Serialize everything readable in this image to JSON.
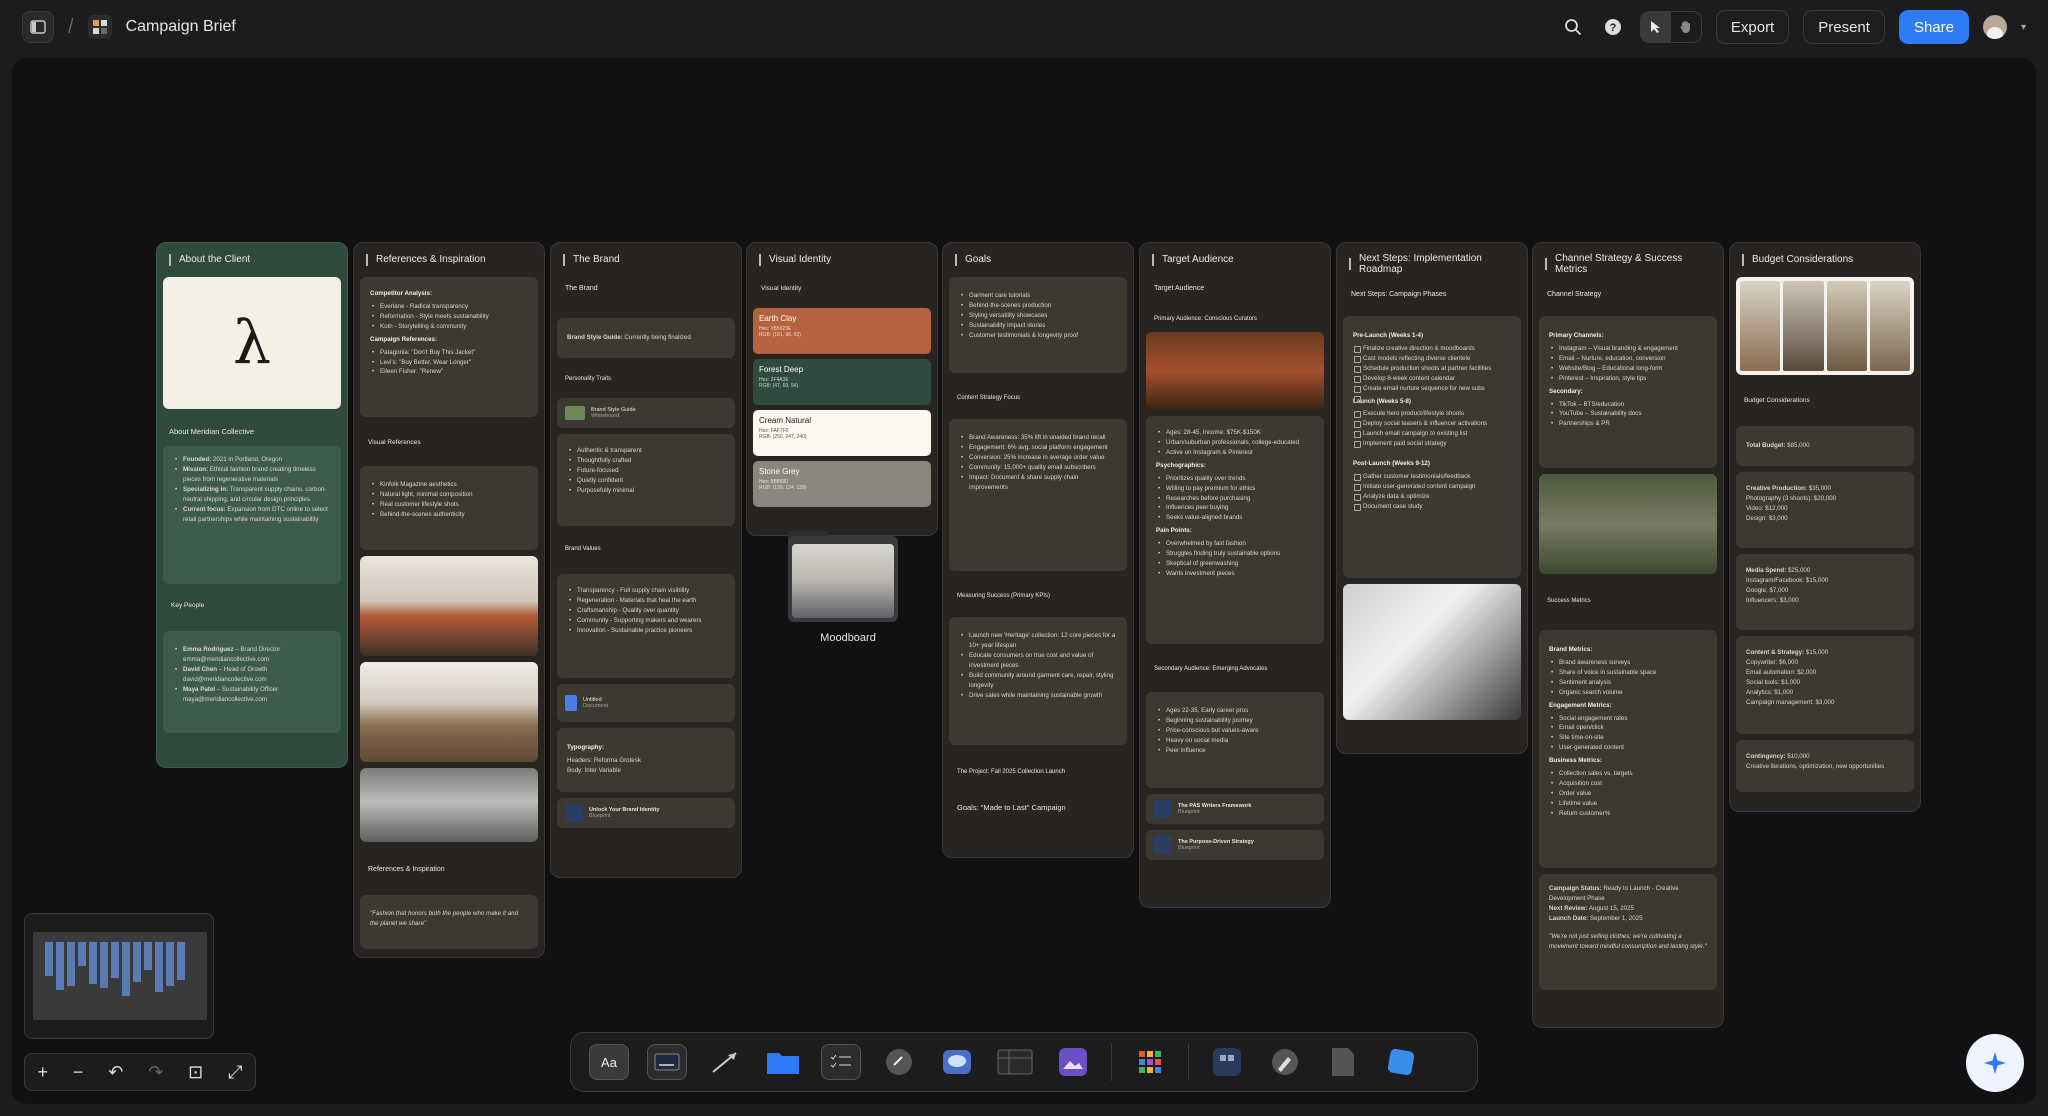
{
  "header": {
    "title": "Campaign Brief",
    "separator": "/",
    "export_label": "Export",
    "present_label": "Present",
    "share_label": "Share"
  },
  "columns": [
    {
      "title": "About the Client",
      "logo_letter": "λ",
      "org": "About Meridian Collective",
      "facts": [
        {
          "k": "Founded:",
          "v": "2021 in Portland, Oregon"
        },
        {
          "k": "Mission:",
          "v": "Ethical fashion brand creating timeless pieces from regenerative materials"
        },
        {
          "k": "Specializing in:",
          "v": "Transparent supply chains, carbon-neutral shipping, and circular design principles"
        },
        {
          "k": "Current focus:",
          "v": "Expansion from DTC online to select retail partnerships while maintaining sustainability"
        }
      ],
      "people_label": "Key People",
      "people": [
        {
          "name": "Emma Rodriguez",
          "role": " – Brand Director",
          "email": "emma@meridiancollective.com"
        },
        {
          "name": "David Chen",
          "role": " – Head of Growth",
          "email": "david@meridiancollective.com"
        },
        {
          "name": "Maya Patel",
          "role": " – Sustainability Officer",
          "email": "maya@meridiancollective.com"
        }
      ]
    },
    {
      "title": "References & Inspiration",
      "competitor_label": "Competitor Analysis:",
      "competitors": [
        "Everlane - Radical transparency",
        "Reformation - Style meets sustainability",
        "Kotn - Storytelling & community"
      ],
      "campaign_label": "Campaign References:",
      "campaigns": [
        "Patagonia: \"Don't Buy This Jacket\"",
        "Levi's: \"Buy Better, Wear Longer\"",
        "Eileen Fisher: \"Renew\""
      ],
      "visual_label": "Visual References",
      "visual": [
        "Kinfolk Magazine aesthetics",
        "Natural light, minimal composition",
        "Real customer lifestyle shots",
        "Behind-the-scenes authenticity"
      ],
      "footer_label": "References & Inspiration",
      "quote": "\"Fashion that honors both the people who make it and the planet we share\""
    },
    {
      "title": "The Brand",
      "sub_title": "The Brand",
      "style_guide_k": "Brand Style Guide:",
      "style_guide_v": " Currently being finalized",
      "traits_label": "Personality Traits",
      "file1_name": "Brand Style Guide",
      "file1_meta": "Whiteboard",
      "traits": [
        "Authentic & transparent",
        "Thoughtfully crafted",
        "Future-focused",
        "Quietly confident",
        "Purposefully minimal"
      ],
      "values_label": "Brand Values",
      "values": [
        "Transparency - Full supply chain visibility",
        "Regeneration - Materials that heal the earth",
        "Craftsmanship - Quality over quantity",
        "Community - Supporting makers and wearers",
        "Innovation - Sustainable practice pioneers"
      ],
      "file2_name": "Untitled",
      "file2_meta": "Document",
      "typo_label": "Typography:",
      "typo_head": "Headers: Reforma Grotesk",
      "typo_body": "Body: Inter Variable",
      "file3_name": "Unlock Your Brand Identity",
      "file3_meta": "Blueprint"
    },
    {
      "title": "Visual Identity",
      "sub_title": "Visual Identity",
      "swatches": [
        {
          "name": "Earth Clay",
          "hex": "Hex: #B5623E",
          "rgb": "RGB: (181, 98, 62)",
          "color": "#b5623e"
        },
        {
          "name": "Forest Deep",
          "hex": "Hex: 2F4A3E",
          "rgb": "RGB: (47, 69, 54)",
          "color": "#2f4a3e"
        },
        {
          "name": "Cream Natural",
          "hex": "Hex: FAF7F0",
          "rgb": "RGB: (250, 247, 240)",
          "color": "#faf7f0"
        },
        {
          "name": "Stone Grey",
          "hex": "Hex: 8B8680",
          "rgb": "RGB: (139, 134, 128)",
          "color": "#8b8680"
        }
      ],
      "folder_label": "Moodboard"
    },
    {
      "title": "Goals",
      "goals": [
        "Garment care tutorials",
        "Behind-the-scenes production",
        "Styling versatility showcases",
        "Sustainability impact stories",
        "Customer testimonials & longevity proof"
      ],
      "focus_label": "Content Strategy Focus",
      "focus": [
        "Brand Awareness: 35% lift in unaided brand recall",
        "Engagement: 6% avg. social platform engagement",
        "Conversion: 25% increase in average order value",
        "Community: 15,000+ quality email subscribers",
        "Impact: Document & share supply chain improvements"
      ],
      "kpi_label": "Measuring Success (Primary KPIs)",
      "kpis": [
        "Launch new 'Heritage' collection: 12 core pieces for a 10+ year lifespan",
        "Educate consumers on true cost and value of investment pieces",
        "Build community around garment care, repair, styling longevity",
        "Drive sales while maintaining sustainable growth"
      ],
      "project_label": "The Project: Fall 2025 Collection Launch",
      "goal_label": "Goals: \"Made to Last\" Campaign"
    },
    {
      "title": "Target Audience",
      "sub_title": "Target Audience",
      "primary_label": "Primary Audience: Conscious Curators",
      "primary": [
        "Ages: 28-45, Income: $75K-$150K",
        "Urban/suburban professionals, college-educated",
        "Active on Instagram & Pinterest"
      ],
      "psy_label": "Psychographics:",
      "psy": [
        "Prioritizes quality over trends",
        "Willing to pay premium for ethics",
        "Researches before purchasing",
        "Influences peer buying",
        "Seeks value-aligned brands"
      ],
      "pain_label": "Pain Points:",
      "pain": [
        "Overwhelmed by fast fashion",
        "Struggles finding truly sustainable options",
        "Skeptical of greenwashing",
        "Wants investment pieces"
      ],
      "secondary_label": "Secondary Audience: Emerging Advocates",
      "secondary": [
        "Ages 22-35, Early career pros",
        "Beginning sustainability journey",
        "Price-conscious but values-aware",
        "Heavy on social media",
        "Peer influence"
      ],
      "file1_name": "The PAS Writers Framework",
      "file1_meta": "Blueprint",
      "file2_name": "The Purpose-Driven Strategy",
      "file2_meta": "Blueprint"
    },
    {
      "title": "Next Steps: Implementation Roadmap",
      "sub_title": "Next Steps: Campaign Phases",
      "pre_label": "Pre-Launch (Weeks 1-4)",
      "pre": [
        "Finalize creative direction & moodboards",
        "Cast models reflecting diverse clientele",
        "Schedule production shoots at partner facilities",
        "Develop 8-week content calendar",
        "Create email nurture sequence for new subs",
        ""
      ],
      "launch_label": "Launch (Weeks 5-8)",
      "launch": [
        "Execute hero product/lifestyle shoots",
        "Deploy social teasers & influencer activations",
        "Launch email campaign to existing list",
        "Implement paid social strategy"
      ],
      "post_label": "Post-Launch (Weeks 9-12)",
      "post": [
        "Gather customer testimonials/feedback",
        "Initiate user-generated content campaign",
        "Analyze data & optimize",
        "Document case study"
      ]
    },
    {
      "title": "Channel Strategy & Success Metrics",
      "sub_title": "Channel Strategy",
      "primary_label": "Primary Channels:",
      "primary": [
        "Instagram – Visual branding & engagement",
        "Email – Nurture, education, conversion",
        "Website/Blog – Educational long-form",
        "Pinterest – Inspiration, style tips"
      ],
      "secondary_label": "Secondary:",
      "secondary": [
        "TikTok – BTS/education",
        "YouTube – Sustainability docs",
        "Partnerships & PR"
      ],
      "metrics_label": "Success Metrics",
      "brand_label": "Brand Metrics:",
      "brand": [
        "Brand awareness surveys",
        "Share of voice in sustainable space",
        "Sentiment analysis",
        "Organic search volume"
      ],
      "eng_label": "Engagement Metrics:",
      "eng": [
        "Social engagement rates",
        "Email open/click",
        "Site time-on-site",
        "User-generated content"
      ],
      "biz_label": "Business Metrics:",
      "biz": [
        "Collection sales vs. targets",
        "Acquisition cost",
        "Order value",
        "Lifetime value",
        "Return customer%"
      ],
      "status_k": "Campaign Status:",
      "status_v": " Ready to Launch - Creative Development Phase",
      "review_k": "Next Review:",
      "review_v": " August 15, 2025",
      "launch_k": "Launch Date:",
      "launch_v": " September 1, 2025",
      "quote": "\"We're not just selling clothes; we're cultivating a movement toward mindful consumption and lasting style.\""
    },
    {
      "title": "Budget Considerations",
      "sub_title": "Budget Considerations",
      "total_k": "Total Budget:",
      "total_v": " $85,000",
      "creative_k": "Creative Production:",
      "creative_v": " $35,000",
      "creative": [
        "Photography (3 shoots): $20,000",
        "Video: $12,000",
        "Design: $3,000"
      ],
      "media_k": "Media Spend:",
      "media_v": " $25,000",
      "media": [
        "Instagram/Facebook: $15,000",
        "Google: $7,000",
        "Influencers: $3,000"
      ],
      "content_k": "Content & Strategy:",
      "content_v": " $15,000",
      "content": [
        "Copywriter: $6,000",
        "Email automation: $2,000",
        "Social tools: $1,000",
        "Analytics: $1,000",
        "Campaign management: $3,000"
      ],
      "cont_k": "Contingency:",
      "cont_v": " $10,000",
      "cont": [
        "Creative iterations, optimization, new opportunities"
      ]
    }
  ],
  "toolbar": {
    "text_tool": "Aa"
  },
  "colors": {
    "accent": "#2f7bf5",
    "canvas": "#111113",
    "card": "#3c3832",
    "client_green": "#2f4a3d"
  }
}
